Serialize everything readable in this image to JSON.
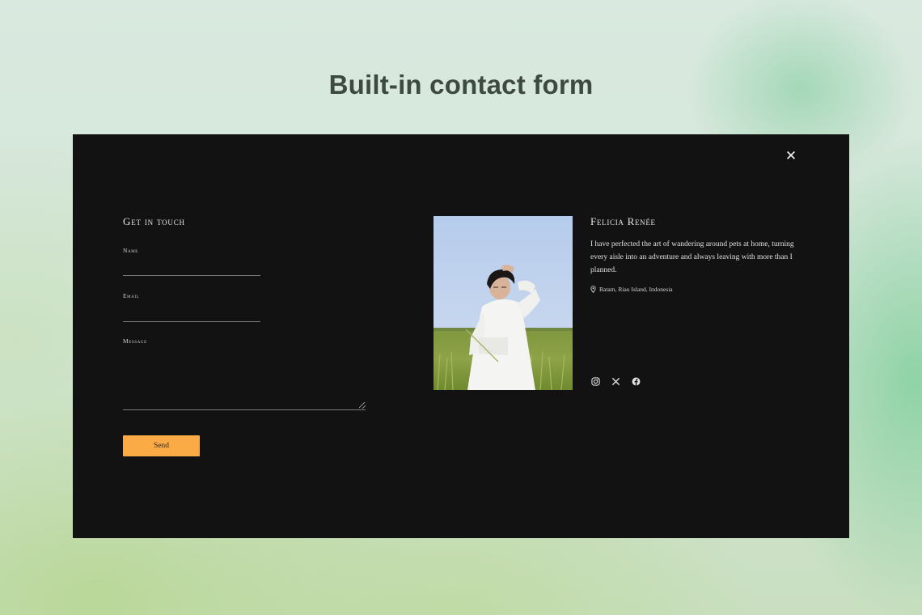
{
  "page": {
    "title": "Built-in contact form"
  },
  "modal": {
    "close_icon": "close-icon"
  },
  "contact_form": {
    "heading": "Get in touch",
    "name_label": "Name",
    "name_value": "",
    "email_label": "Email",
    "email_value": "",
    "message_label": "Message",
    "message_value": "",
    "send_label": "Send"
  },
  "profile": {
    "name": "Felicia Renée",
    "bio": "I have perfected the art of wandering around pets at home, turning every aisle into an adventure and always leaving with more than I planned.",
    "location": "Batam, Riau Island, Indonesia",
    "location_icon": "location-pin-icon",
    "social": [
      "instagram-icon",
      "x-icon",
      "facebook-icon"
    ]
  },
  "colors": {
    "modal_background": "#121212",
    "accent": "#fbab45",
    "title_text": "#3e4a40"
  }
}
